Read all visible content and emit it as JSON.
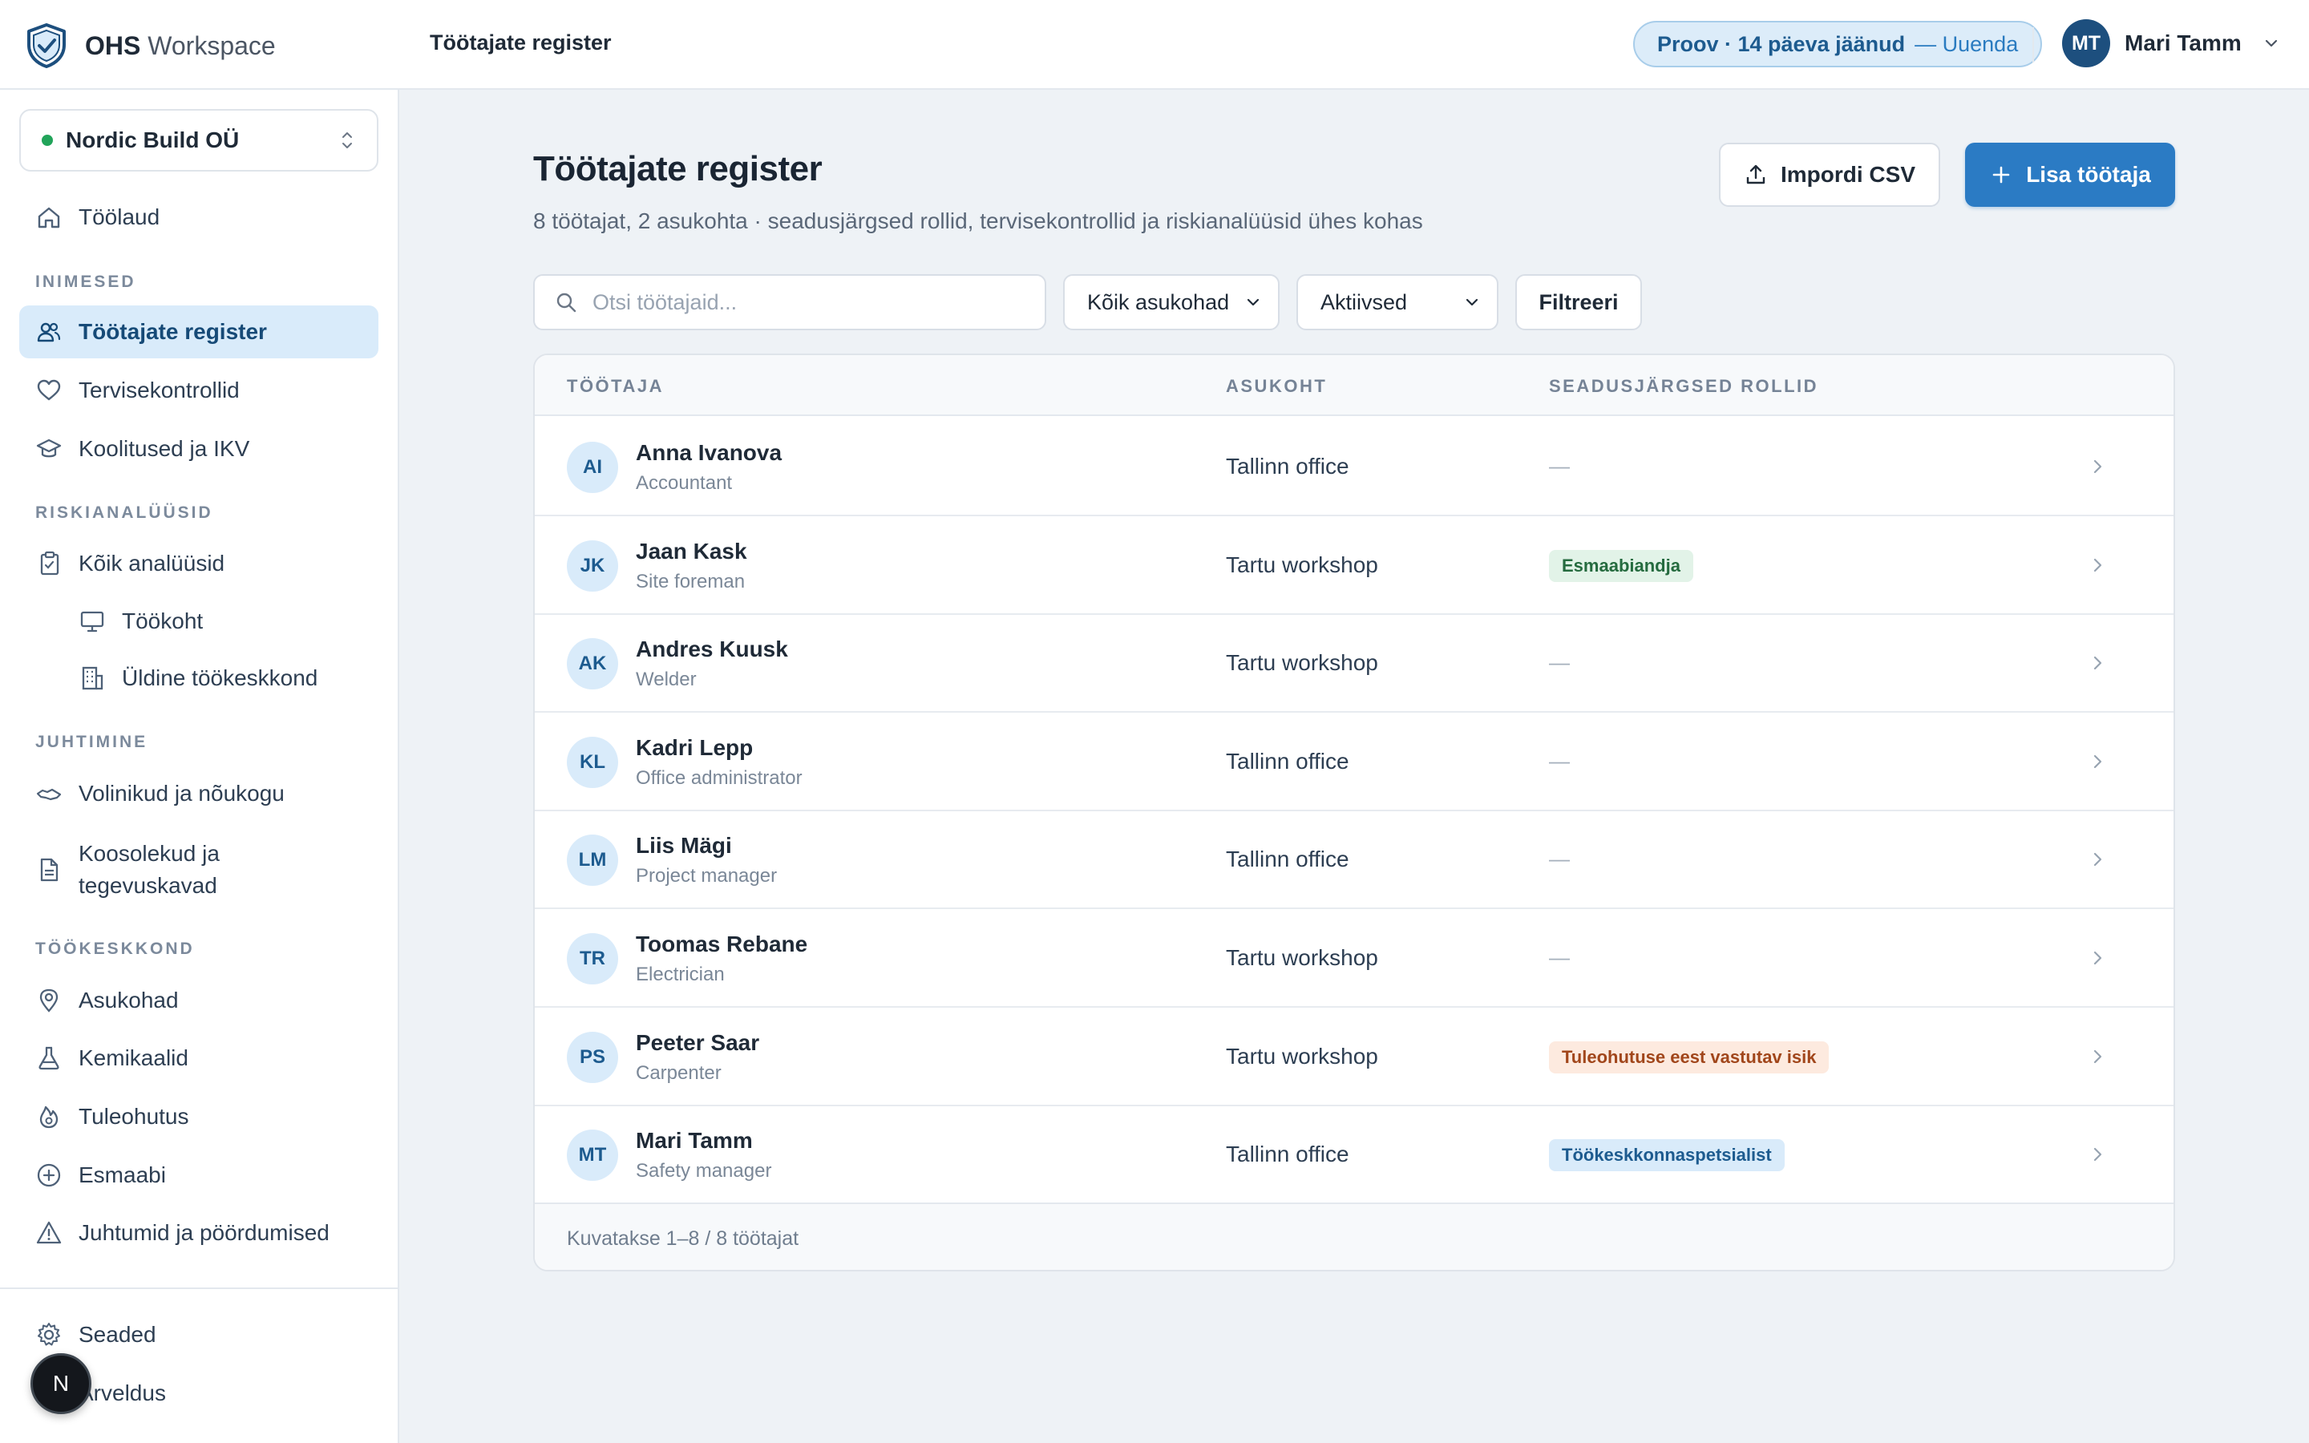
{
  "brand": {
    "name_bold": "OHS",
    "name_rest": "Workspace"
  },
  "header": {
    "title": "Töötajate register",
    "trial_text": "Proov · 14 päeva jäänud",
    "trial_link": "— Uuenda",
    "user_initials": "MT",
    "user_name": "Mari Tamm"
  },
  "sidebar": {
    "org_name": "Nordic Build OÜ",
    "org_status_color": "#22a45a",
    "home": "Töölaud",
    "sections": {
      "people": "INIMESED",
      "risk": "RISKIANALÜÜSID",
      "management": "JUHTIMINE",
      "environment": "TÖÖKESKKOND"
    },
    "items": {
      "register": "Töötajate register",
      "health": "Tervisekontrollid",
      "trainings": "Koolitused ja IKV",
      "all_analyses": "Kõik analüüsid",
      "workplace": "Töökoht",
      "general_env": "Üldine töökeskkond",
      "reps": "Volinikud ja nõukogu",
      "meetings": "Koosolekud ja tegevuskavad",
      "locations": "Asukohad",
      "chemicals": "Kemikaalid",
      "fire": "Tuleohutus",
      "first_aid": "Esmaabi",
      "incidents": "Juhtumid ja pöördumised",
      "settings": "Seaded",
      "billing": "Arveldus"
    },
    "fab_label": "N"
  },
  "main": {
    "title": "Töötajate register",
    "subtitle": "8 töötajat, 2 asukohta · seadusjärgsed rollid, tervisekontrollid ja riskianalüüsid ühes kohas",
    "import_label": "Impordi CSV",
    "add_label": "Lisa töötaja",
    "search_placeholder": "Otsi töötajaid...",
    "location_filter": "Kõik asukohad",
    "status_filter": "Aktiivsed",
    "filter_button": "Filtreeri",
    "columns": {
      "employee": "TÖÖTAJA",
      "location": "ASUKOHT",
      "roles": "SEADUSJÄRGSED ROLLID"
    },
    "rows": [
      {
        "initials": "AI",
        "name": "Anna Ivanova",
        "title": "Accountant",
        "location": "Tallinn office",
        "role": "",
        "role_color": ""
      },
      {
        "initials": "JK",
        "name": "Jaan Kask",
        "title": "Site foreman",
        "location": "Tartu workshop",
        "role": "Esmaabiandja",
        "role_color": "green"
      },
      {
        "initials": "AK",
        "name": "Andres Kuusk",
        "title": "Welder",
        "location": "Tartu workshop",
        "role": "",
        "role_color": ""
      },
      {
        "initials": "KL",
        "name": "Kadri Lepp",
        "title": "Office administrator",
        "location": "Tallinn office",
        "role": "",
        "role_color": ""
      },
      {
        "initials": "LM",
        "name": "Liis Mägi",
        "title": "Project manager",
        "location": "Tallinn office",
        "role": "",
        "role_color": ""
      },
      {
        "initials": "TR",
        "name": "Toomas Rebane",
        "title": "Electrician",
        "location": "Tartu workshop",
        "role": "",
        "role_color": ""
      },
      {
        "initials": "PS",
        "name": "Peeter Saar",
        "title": "Carpenter",
        "location": "Tartu workshop",
        "role": "Tuleohutuse eest vastutav isik",
        "role_color": "orange"
      },
      {
        "initials": "MT",
        "name": "Mari Tamm",
        "title": "Safety manager",
        "location": "Tallinn office",
        "role": "Töökeskkonnaspetsialist",
        "role_color": "blue"
      }
    ],
    "empty_role": "—",
    "footer": "Kuvatakse 1–8 / 8 töötajat"
  },
  "colors": {
    "accent": "#2b7bc4",
    "active_bg": "#d9ebfa",
    "trial_bg": "#dcecf9"
  }
}
